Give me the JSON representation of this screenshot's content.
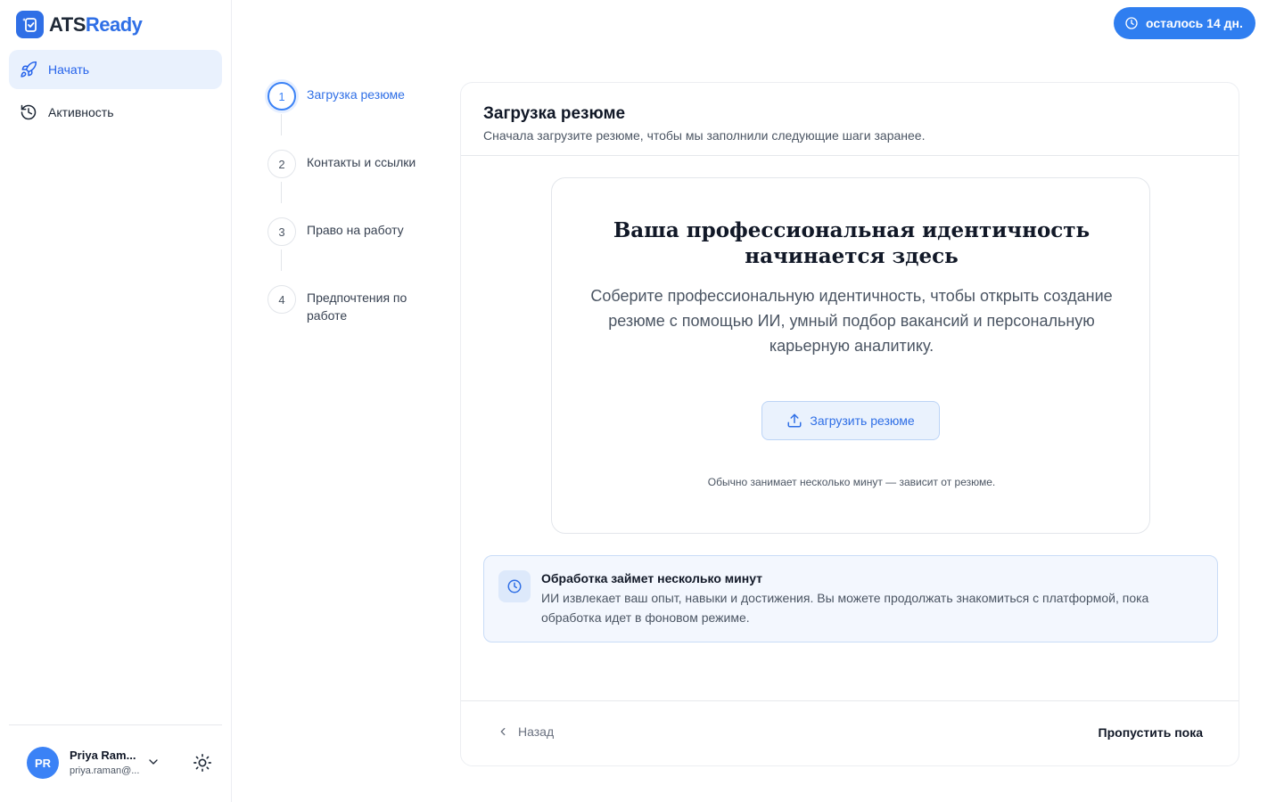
{
  "brand": {
    "name_prefix": "ATS",
    "name_accent": "Ready"
  },
  "sidebar": {
    "items": [
      {
        "label": "Начать",
        "icon": "rocket-icon",
        "active": true
      },
      {
        "label": "Активность",
        "icon": "history-icon",
        "active": false
      }
    ]
  },
  "user": {
    "initials": "PR",
    "name": "Priya Ram...",
    "email": "priya.raman@..."
  },
  "header": {
    "trial_label": "осталось 14 дн."
  },
  "steps": [
    {
      "number": "1",
      "label": "Загрузка резюме"
    },
    {
      "number": "2",
      "label": "Контакты и ссылки"
    },
    {
      "number": "3",
      "label": "Право на работу"
    },
    {
      "number": "4",
      "label": "Предпочтения по работе"
    }
  ],
  "card": {
    "title": "Загрузка резюме",
    "subtitle": "Сначала загрузите резюме, чтобы мы заполнили следующие шаги заранее.",
    "upload": {
      "heading": "Ваша профессиональная идентичность начинается здесь",
      "description": "Соберите профессиональную идентичность, чтобы открыть создание резюме с помощью ИИ, умный подбор вакансий и персональную карьерную аналитику.",
      "button_label": "Загрузить резюме",
      "note": "Обычно занимает несколько минут — зависит от резюме."
    },
    "info": {
      "title": "Обработка займет несколько минут",
      "text": "ИИ извлекает ваш опыт, навыки и достижения. Вы можете продолжать знакомиться с платформой, пока обработка идет в фоновом режиме."
    },
    "footer": {
      "back_label": "Назад",
      "skip_label": "Пропустить пока"
    }
  },
  "colors": {
    "accent": "#2f6fe6",
    "trial_bg": "#2f7ef0",
    "info_bg": "#f3f7fe"
  }
}
